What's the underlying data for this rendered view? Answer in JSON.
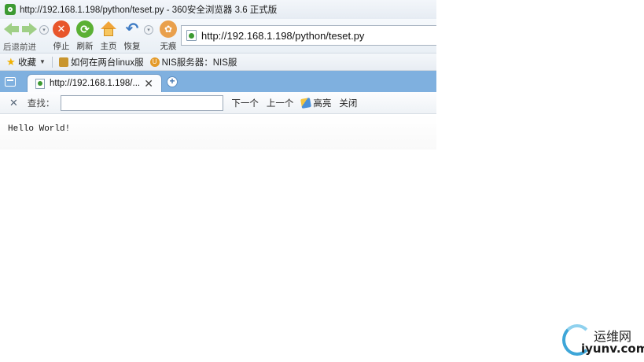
{
  "window": {
    "title": "http://192.168.1.198/python/teset.py - 360安全浏览器 3.6 正式版"
  },
  "toolbar": {
    "back_forward_label": "后退前进",
    "stop_label": "停止",
    "refresh_label": "刷新",
    "home_label": "主页",
    "restore_label": "恢复",
    "notrace_label": "无痕"
  },
  "address_bar": {
    "url": "http://192.168.1.198/python/teset.py"
  },
  "favorites_bar": {
    "favorites_label": "收藏",
    "items": [
      {
        "label": "如何在两台linux服"
      },
      {
        "label": "NIS服务器：NIS服"
      }
    ]
  },
  "tabs": [
    {
      "title": "http://192.168.1.198/...",
      "active": true
    }
  ],
  "find_bar": {
    "close_glyph": "✕",
    "label": "查找：",
    "value": "",
    "next_label": "下一个",
    "prev_label": "上一个",
    "highlight_label": "高亮",
    "close_label": "关闭"
  },
  "page": {
    "body_text": "Hello World!"
  },
  "watermark": {
    "cn": "运维网",
    "en": "iyunv.com"
  },
  "colors": {
    "tabbar": "#7fb0df",
    "stop": "#e8562b",
    "refresh": "#5bb034",
    "home": "#f0a53a",
    "restore": "#3e7bc4"
  }
}
